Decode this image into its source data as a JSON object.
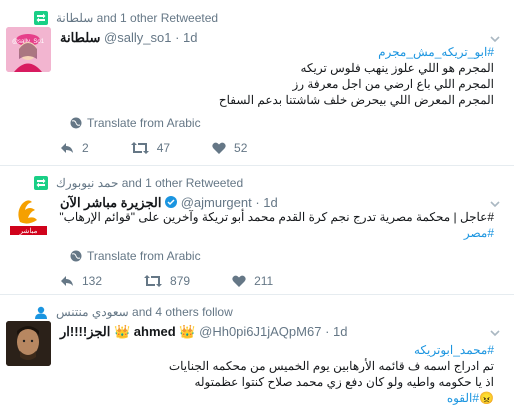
{
  "tweets": [
    {
      "context": {
        "user": "سلطانة",
        "suffix": "and 1 other Retweeted"
      },
      "name": "سلطانة",
      "handle": "@sally_so1",
      "time": "1d",
      "lines": [
        "#ابو_تريكه_مش_مجرم",
        "المجرم هو اللي علوز ينهب فلوس تريكه",
        "المجرم اللي باع ارضي من اجل معرفة رز",
        "المجرم  المعرض اللي بيحرض خلف شاشتنا بدعم السفاح"
      ],
      "translate": "Translate from Arabic",
      "reply": "2",
      "retweets": "47",
      "likes": "52"
    },
    {
      "context": {
        "user": "حمد نيوبورك",
        "suffix": "and 1 other Retweeted"
      },
      "name": "الجزيرة مباشر الآن",
      "handle": "@ajmurgent",
      "time": "1d",
      "lines": [
        "#عاجل | محكمة مصرية تدرج نجم كرة القدم محمد أبو تريكة وآخرين على \"قوائم الإرهاب\"",
        "#مصر"
      ],
      "translate": "Translate from Arabic",
      "reply": "132",
      "retweets": "879",
      "likes": "211"
    },
    {
      "context": {
        "user": "سعودي منتنس",
        "suffix": "and 4 others follow"
      },
      "name": "ahmed",
      "name_prefix": "الجز!!!!ار",
      "handle": "@Hh0pi6J1jAQpM67",
      "time": "1d",
      "lines": [
        "#محمد_ابوتريكه",
        "تم ادراج اسمه ف قائمه الأرهابين يوم الخميس من محكمه الجنايات",
        "اذ يا حكومه واطيه ولو كان دفع زي محمد صلاح كنتوا عظمتوله",
        "#القوه"
      ]
    }
  ],
  "colors": {
    "accent": "#1b95e0",
    "retweet": "#19cf86",
    "muted": "#657786"
  }
}
